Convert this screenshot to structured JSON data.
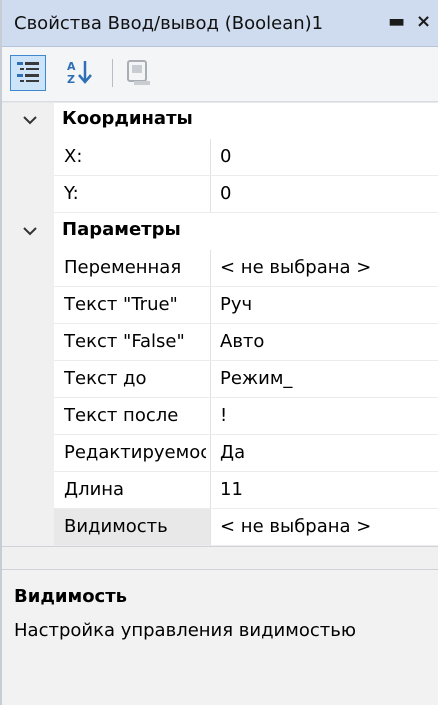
{
  "window": {
    "title": "Свойства Ввод/вывод (Boolean)1",
    "pin_glyph": "▬",
    "close_glyph": "×"
  },
  "toolbar": {
    "buttons": [
      {
        "icon": "categorized-icon",
        "active": true
      },
      {
        "icon": "sort-alphabetical-icon",
        "active": false
      },
      {
        "icon": "property-pages-icon",
        "active": false
      }
    ]
  },
  "grid": {
    "categories": [
      {
        "label": "Координаты",
        "properties": [
          {
            "name": "X:",
            "value": "0"
          },
          {
            "name": "Y:",
            "value": "0"
          }
        ]
      },
      {
        "label": "Параметры",
        "properties": [
          {
            "name": "Переменная",
            "value": "< не выбрана >"
          },
          {
            "name": "Текст \"True\"",
            "value": "Руч"
          },
          {
            "name": "Текст \"False\"",
            "value": "Авто"
          },
          {
            "name": "Текст до",
            "value": "Режим_"
          },
          {
            "name": "Текст после",
            "value": "!"
          },
          {
            "name": "Редактируемость",
            "value": "Да"
          },
          {
            "name": "Длина",
            "value": "11"
          },
          {
            "name": "Видимость",
            "value": "< не выбрана >"
          }
        ]
      }
    ]
  },
  "description": {
    "title": "Видимость",
    "text": "Настройка управления видимостью"
  },
  "colors": {
    "titlebar_bg": "#cfdcef",
    "active_button_bg": "#cde3f7",
    "active_button_border": "#3f88cf",
    "gutter_bg": "#f0f0f0",
    "selected_row_bg": "#e8e8e8"
  }
}
